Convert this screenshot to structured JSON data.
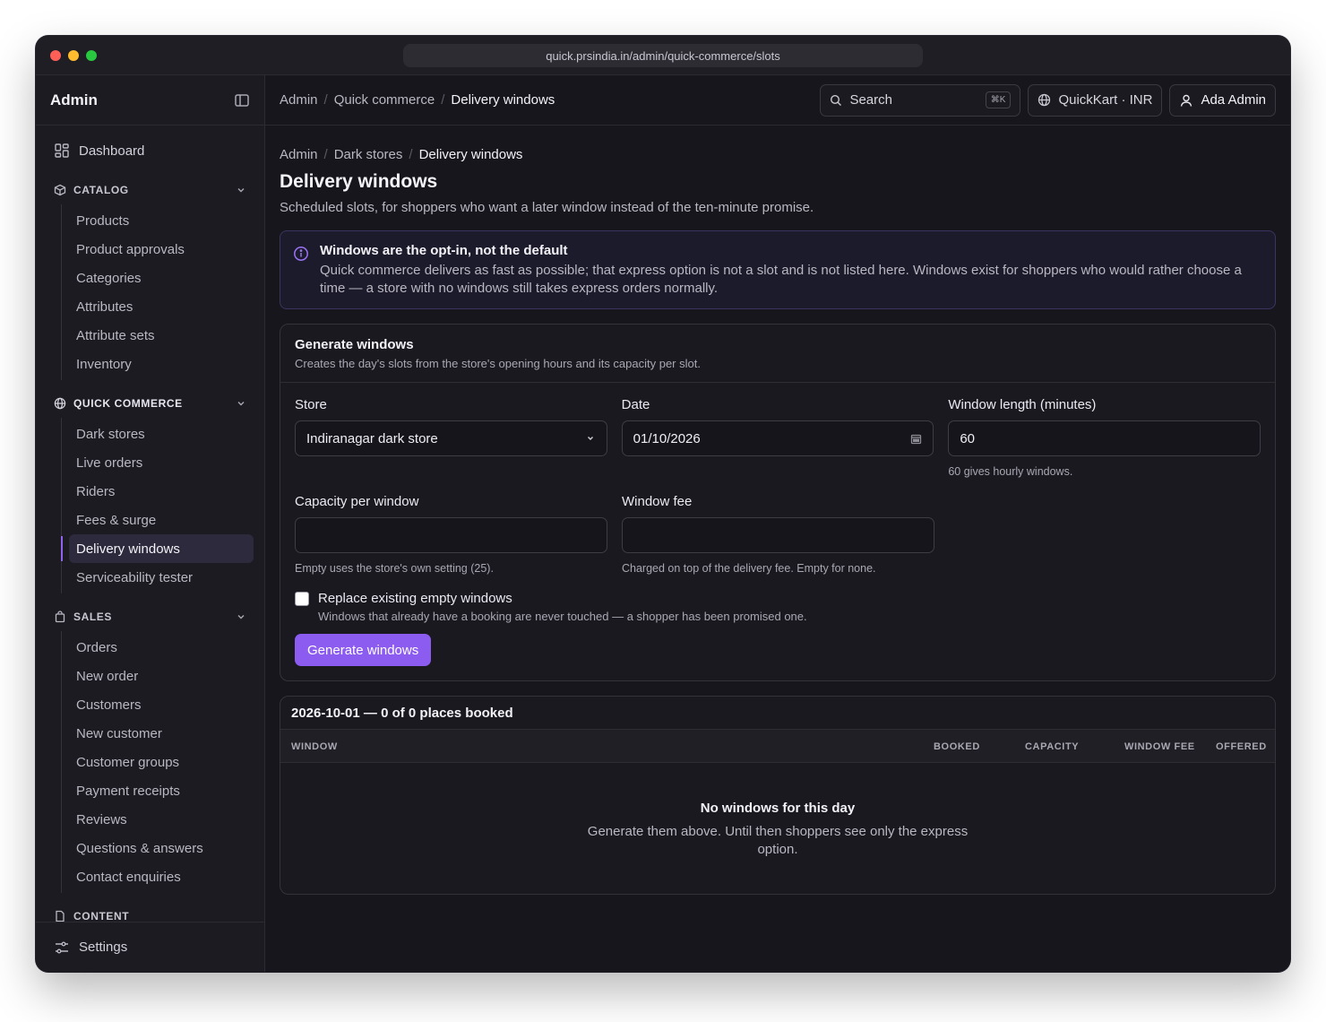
{
  "browser": {
    "url": "quick.prsindia.in/admin/quick-commerce/slots"
  },
  "sidebar": {
    "title": "Admin",
    "dashboard": "Dashboard",
    "sections": {
      "catalog": {
        "label": "CATALOG",
        "items": [
          "Products",
          "Product approvals",
          "Categories",
          "Attributes",
          "Attribute sets",
          "Inventory"
        ]
      },
      "quick_commerce": {
        "label": "QUICK COMMERCE",
        "items": [
          "Dark stores",
          "Live orders",
          "Riders",
          "Fees & surge",
          "Delivery windows",
          "Serviceability tester"
        ],
        "active": "Delivery windows"
      },
      "sales": {
        "label": "SALES",
        "items": [
          "Orders",
          "New order",
          "Customers",
          "New customer",
          "Customer groups",
          "Payment receipts",
          "Reviews",
          "Questions & answers",
          "Contact enquiries"
        ]
      },
      "content": {
        "label": "CONTENT"
      }
    },
    "settings": "Settings"
  },
  "topbar": {
    "breadcrumb": [
      "Admin",
      "Quick commerce",
      "Delivery windows"
    ],
    "search_label": "Search",
    "search_shortcut": "⌘K",
    "store_switch": "QuickKart · INR",
    "user": "Ada Admin"
  },
  "page": {
    "breadcrumb": [
      "Admin",
      "Dark stores",
      "Delivery windows"
    ],
    "title": "Delivery windows",
    "subtitle": "Scheduled slots, for shoppers who want a later window instead of the ten-minute promise."
  },
  "alert": {
    "title": "Windows are the opt-in, not the default",
    "body": "Quick commerce delivers as fast as possible; that express option is not a slot and is not listed here. Windows exist for shoppers who would rather choose a time — a store with no windows still takes express orders normally."
  },
  "generate": {
    "title": "Generate windows",
    "description": "Creates the day's slots from the store's opening hours and its capacity per slot.",
    "store": {
      "label": "Store",
      "value": "Indiranagar dark store"
    },
    "date": {
      "label": "Date",
      "value": "01/10/2026"
    },
    "window_length": {
      "label": "Window length (minutes)",
      "value": "60",
      "hint": "60 gives hourly windows."
    },
    "capacity": {
      "label": "Capacity per window",
      "value": "",
      "hint": "Empty uses the store's own setting (25)."
    },
    "fee": {
      "label": "Window fee",
      "value": "",
      "hint": "Charged on top of the delivery fee. Empty for none."
    },
    "replace": {
      "label": "Replace existing empty windows",
      "hint": "Windows that already have a booking are never touched — a shopper has been promised one.",
      "checked": false
    },
    "button": "Generate windows"
  },
  "table": {
    "caption": "2026-10-01 — 0 of 0 places booked",
    "columns": [
      "WINDOW",
      "BOOKED",
      "CAPACITY",
      "WINDOW FEE",
      "OFFERED"
    ],
    "empty_title": "No windows for this day",
    "empty_text": "Generate them above. Until then shoppers see only the express option."
  },
  "colors": {
    "accent": "#8c5cf0",
    "background": "#17161c",
    "sidebar": "#1c1b21"
  }
}
